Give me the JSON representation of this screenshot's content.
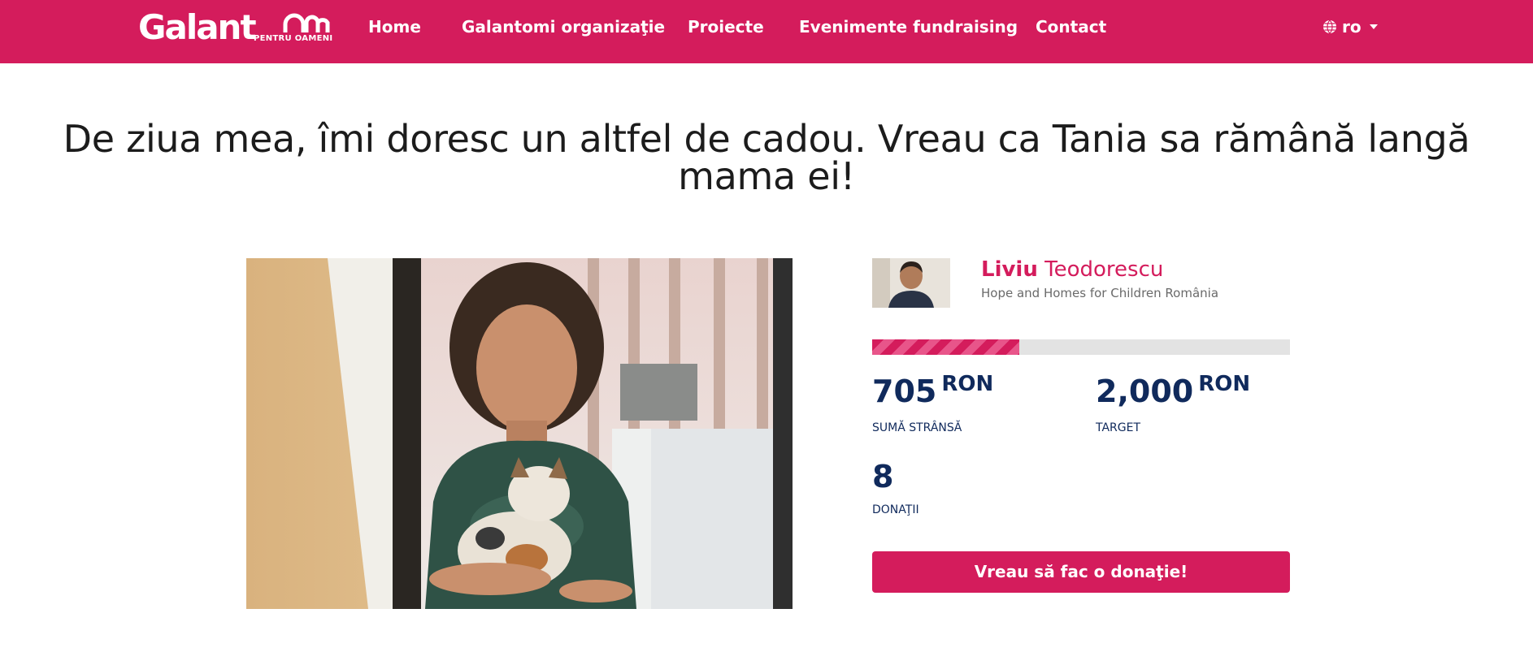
{
  "nav": {
    "logo_word": "Galant",
    "logo_sub": "PENTRU OAMENI",
    "items": [
      {
        "label": "Home"
      },
      {
        "label": "Galantomi organizaţie"
      },
      {
        "label": "Proiecte"
      },
      {
        "label": "Evenimente fundraising"
      },
      {
        "label": "Contact"
      }
    ],
    "language": "ro"
  },
  "campaign": {
    "title": "De ziua mea, îmi doresc un altfel de cadou. Vreau ca Tania sa rămână langă mama ei!",
    "fundraiser_first": "Liviu",
    "fundraiser_last": "Teodorescu",
    "organization": "Hope and Homes for Children România",
    "raised": "705",
    "target": "2,000",
    "currency": "RON",
    "raised_label": "SUMĂ STRÂNSĂ",
    "target_label": "TARGET",
    "donations": "8",
    "donations_label": "DONAŢII",
    "progress_fraction": 0.3525,
    "donate_label": "Vreau să fac o donaţie!"
  },
  "colors": {
    "brand": "#d41c5c",
    "stat_text": "#102a5c"
  }
}
